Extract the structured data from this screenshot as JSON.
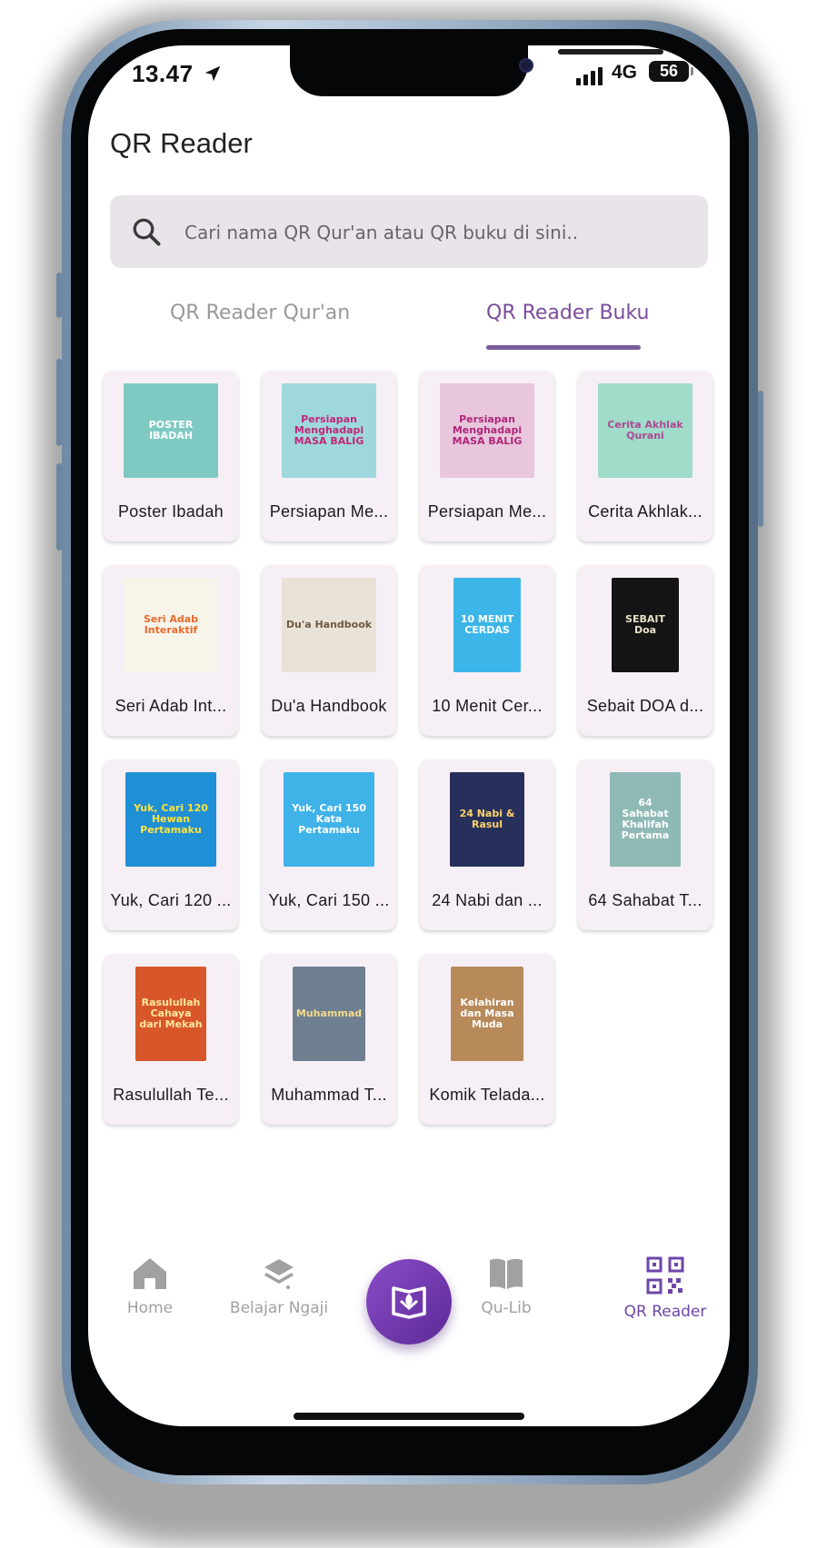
{
  "status_bar": {
    "time": "13.47",
    "network": "4G",
    "battery": "56"
  },
  "header": {
    "title": "QR Reader"
  },
  "search": {
    "placeholder": "Cari nama QR Qur'an atau QR buku di sini.."
  },
  "tabs": [
    {
      "label": "QR Reader Qur'an",
      "active": false
    },
    {
      "label": "QR Reader Buku",
      "active": true
    }
  ],
  "books": [
    {
      "label": "Poster Ibadah",
      "cover_text": "POSTER IBADAH",
      "bg": "#7fc9c3",
      "fg": "#ffffff"
    },
    {
      "label": "Persiapan Me...",
      "cover_text": "Persiapan Menghadapi MASA BALIG",
      "bg": "#9fd8dc",
      "fg": "#c0267a"
    },
    {
      "label": "Persiapan Me...",
      "cover_text": "Persiapan Menghadapi MASA BALIG",
      "bg": "#e8c6dc",
      "fg": "#b0267a"
    },
    {
      "label": "Cerita Akhlak...",
      "cover_text": "Cerita Akhlak Qurani",
      "bg": "#9fdcc9",
      "fg": "#b04894"
    },
    {
      "label": "Seri Adab Int...",
      "cover_text": "Seri Adab Interaktif",
      "bg": "#f7f4ea",
      "fg": "#e86a2c"
    },
    {
      "label": "Du'a Handbook",
      "cover_text": "Du'a Handbook",
      "bg": "#e9e2d6",
      "fg": "#6b5a44"
    },
    {
      "label": "10 Menit Cer...",
      "cover_text": "10 MENIT CERDAS",
      "bg": "#3cb6e8",
      "fg": "#ffffff"
    },
    {
      "label": "Sebait DOA d...",
      "cover_text": "SEBAIT Doa",
      "bg": "#141414",
      "fg": "#e8e0c8"
    },
    {
      "label": "Yuk, Cari 120 ...",
      "cover_text": "Yuk, Cari 120 Hewan Pertamaku",
      "bg": "#1f8fd6",
      "fg": "#ffe23a"
    },
    {
      "label": "Yuk, Cari 150 ...",
      "cover_text": "Yuk, Cari 150 Kata Pertamaku",
      "bg": "#3fb3e8",
      "fg": "#ffffff"
    },
    {
      "label": "24 Nabi dan ...",
      "cover_text": "24 Nabi & Rasul",
      "bg": "#27305a",
      "fg": "#ffd36a"
    },
    {
      "label": "64 Sahabat T...",
      "cover_text": "64 Sahabat Khalifah Pertama",
      "bg": "#8fb9b4",
      "fg": "#ffffff"
    },
    {
      "label": "Rasulullah Te...",
      "cover_text": "Rasulullah Cahaya dari Mekah",
      "bg": "#d8572a",
      "fg": "#ffe7a0"
    },
    {
      "label": "Muhammad T...",
      "cover_text": "Muhammad",
      "bg": "#6e7f91",
      "fg": "#f4d98a"
    },
    {
      "label": "Komik Telada...",
      "cover_text": "Kelahiran dan Masa Muda",
      "bg": "#b88a5a",
      "fg": "#ffffff"
    }
  ],
  "bottom_nav": [
    {
      "label": "Home",
      "icon": "home-icon",
      "active": false
    },
    {
      "label": "Belajar Ngaji",
      "icon": "layers-icon",
      "active": false
    },
    {
      "label": "",
      "icon": "book-center-icon",
      "active": false
    },
    {
      "label": "Qu-Lib",
      "icon": "open-book-icon",
      "active": false
    },
    {
      "label": "QR Reader",
      "icon": "qr-code-icon",
      "active": true
    }
  ],
  "colors": {
    "accent": "#7b4d9c",
    "search_bg": "#e9e3ea",
    "card_bg": "#f6eff6",
    "inactive": "#a1a1a1"
  }
}
